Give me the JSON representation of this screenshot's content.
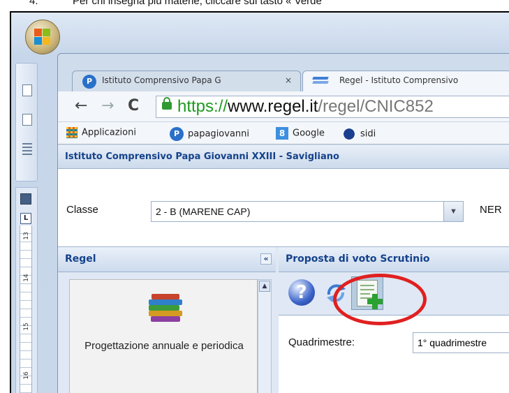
{
  "caption": {
    "number": "4.",
    "text": "Per chi insegna più materie, cliccare sul tasto « Verde"
  },
  "word": {
    "ruler_labels": [
      "13",
      "14",
      "15",
      "16"
    ]
  },
  "browser": {
    "tabs": [
      {
        "label": "Istituto Comprensivo Papa G",
        "close": "×"
      },
      {
        "label": "Regel - Istituto Comprensivo"
      }
    ],
    "nav": {
      "back": "←",
      "forward": "→",
      "reload": "C"
    },
    "url": {
      "scheme": "https://",
      "host": "www.regel.it",
      "path": "/regel/CNIC852"
    },
    "bookmarks": [
      "Applicazioni",
      "papagiovanni",
      "Google",
      "sidi"
    ]
  },
  "page": {
    "school_title": "Istituto Comprensivo Papa Giovanni XXIII - Savigliano",
    "classe_label": "Classe",
    "classe_value": "2 - B (MARENE CAP)",
    "classe_arrow": "▼",
    "right_label": "NER",
    "left_panel": {
      "title": "Regel",
      "collapse": "«",
      "scroll_up": "▲",
      "menu_item": "Progettazione annuale e periodica"
    },
    "right_panel": {
      "title": "Proposta di voto Scrutinio",
      "help": "?",
      "quadrimestre_label": "Quadrimestre:",
      "quadrimestre_value": "1° quadrimestre"
    }
  },
  "colors": {
    "highlight": "#e02020",
    "panel_title": "#15428b"
  },
  "icons": [
    "office-logo-icon",
    "paste-icon",
    "new-doc-icon",
    "lines-icon",
    "save-icon",
    "lock-icon",
    "apps-icon",
    "help-icon",
    "refresh-icon",
    "add-sheet-icon",
    "books-icon"
  ]
}
